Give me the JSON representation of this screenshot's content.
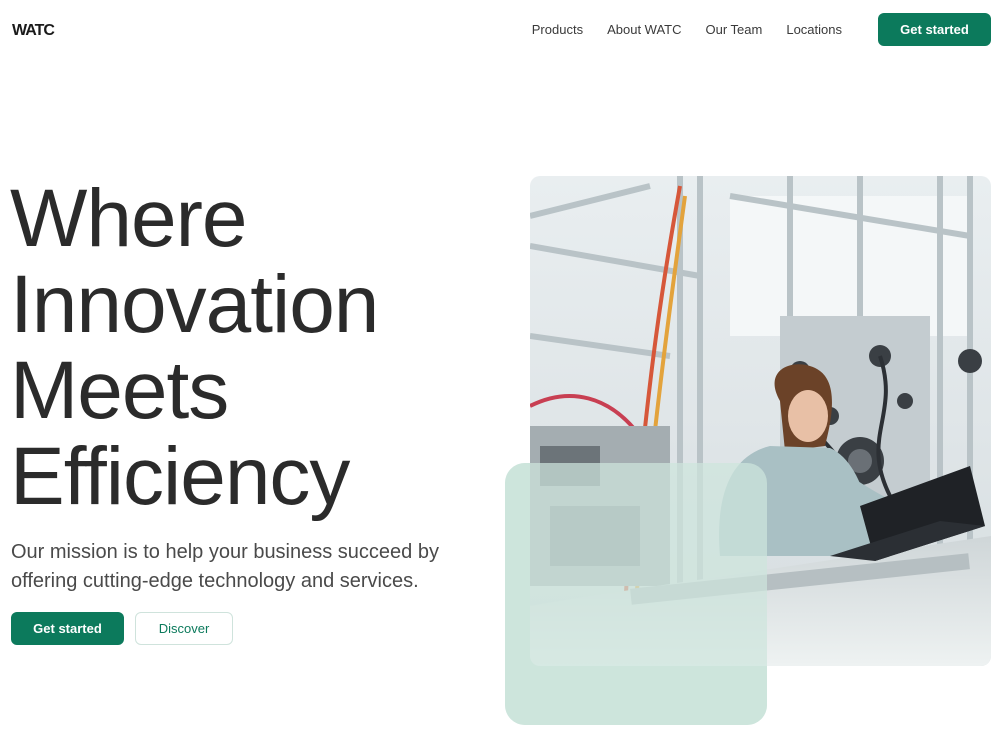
{
  "brand": {
    "logo_text": "WATC",
    "accent_color": "#0c7a5c",
    "accent_light": "#cde4dc"
  },
  "nav": {
    "links": [
      "Products",
      "About WATC",
      "Our Team",
      "Locations"
    ],
    "cta_label": "Get started"
  },
  "hero": {
    "title_lines": [
      "Where",
      "Innovation",
      "Meets",
      "Efficiency"
    ],
    "subtitle": "Our mission is to help your business succeed by offering cutting-edge technology and services.",
    "primary_button": "Get started",
    "secondary_button": "Discover"
  }
}
